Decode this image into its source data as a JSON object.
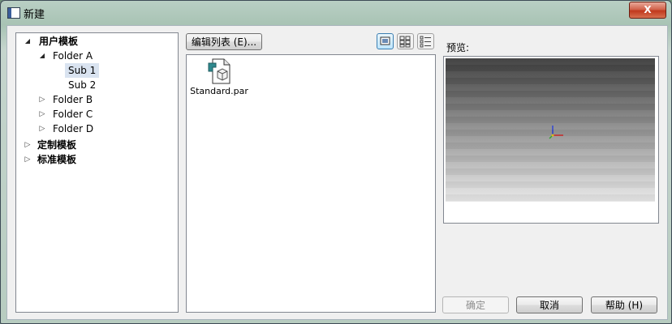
{
  "window": {
    "title": "新建",
    "close_label": "X"
  },
  "tree": {
    "items": [
      {
        "label": "用户模板",
        "level": 0,
        "expanded": true,
        "bold": true
      },
      {
        "label": "Folder A",
        "level": 1,
        "expanded": true
      },
      {
        "label": "Sub 1",
        "level": 2,
        "selected": true
      },
      {
        "label": "Sub 2",
        "level": 2
      },
      {
        "label": "Folder B",
        "level": 1,
        "expanded": false
      },
      {
        "label": "Folder C",
        "level": 1,
        "expanded": false
      },
      {
        "label": "Folder D",
        "level": 1,
        "expanded": false
      },
      {
        "label": "定制模板",
        "level": 0,
        "expanded": false,
        "bold": true
      },
      {
        "label": "标准模板",
        "level": 0,
        "expanded": false,
        "bold": true
      }
    ]
  },
  "toolbar": {
    "edit_list_label": "编辑列表 (E)..."
  },
  "view_buttons": [
    {
      "icon": "large-icon-view-icon",
      "active": true
    },
    {
      "icon": "small-icon-view-icon",
      "active": false
    },
    {
      "icon": "list-view-icon",
      "active": false
    }
  ],
  "files": [
    {
      "name": "Standard.par",
      "icon": "part-file-icon"
    }
  ],
  "preview": {
    "label": "预览:"
  },
  "buttons": {
    "ok": "确定",
    "cancel": "取消",
    "help": "帮助 (H)"
  },
  "colors": {
    "selection": "#d9e3f0",
    "close_button": "#c0391d",
    "active_view": "#3c7fb1"
  }
}
